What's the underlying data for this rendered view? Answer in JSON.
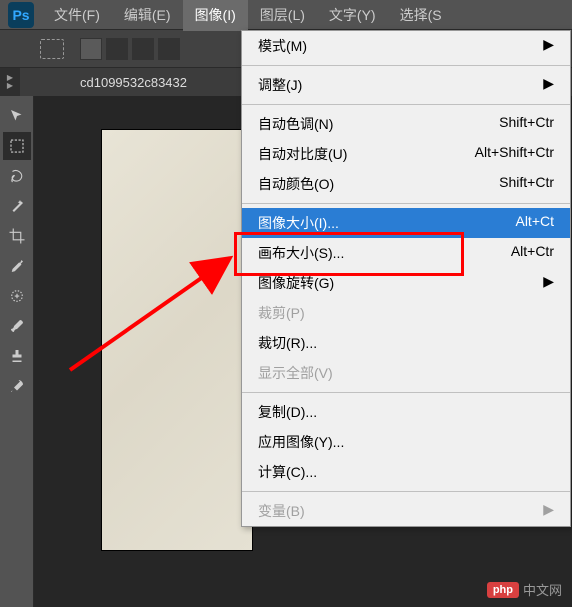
{
  "logo": "Ps",
  "menubar": {
    "file": "文件(F)",
    "edit": "编辑(E)",
    "image": "图像(I)",
    "layer": "图层(L)",
    "text": "文字(Y)",
    "select": "选择(S"
  },
  "doctab": "cd1099532c83432",
  "dropdown": {
    "mode": "模式(M)",
    "adjust": "调整(J)",
    "auto_tone": {
      "label": "自动色调(N)",
      "shortcut": "Shift+Ctr"
    },
    "auto_contrast": {
      "label": "自动对比度(U)",
      "shortcut": "Alt+Shift+Ctr"
    },
    "auto_color": {
      "label": "自动颜色(O)",
      "shortcut": "Shift+Ctr"
    },
    "image_size": {
      "label": "图像大小(I)...",
      "shortcut": "Alt+Ct"
    },
    "canvas_size": {
      "label": "画布大小(S)...",
      "shortcut": "Alt+Ctr"
    },
    "rotate": "图像旋转(G)",
    "crop": "裁剪(P)",
    "trim": "裁切(R)...",
    "reveal_all": "显示全部(V)",
    "duplicate": "复制(D)...",
    "apply_image": "应用图像(Y)...",
    "calc": "计算(C)...",
    "variables": "变量(B)"
  },
  "watermark": {
    "badge": "php",
    "text": "中文网"
  }
}
